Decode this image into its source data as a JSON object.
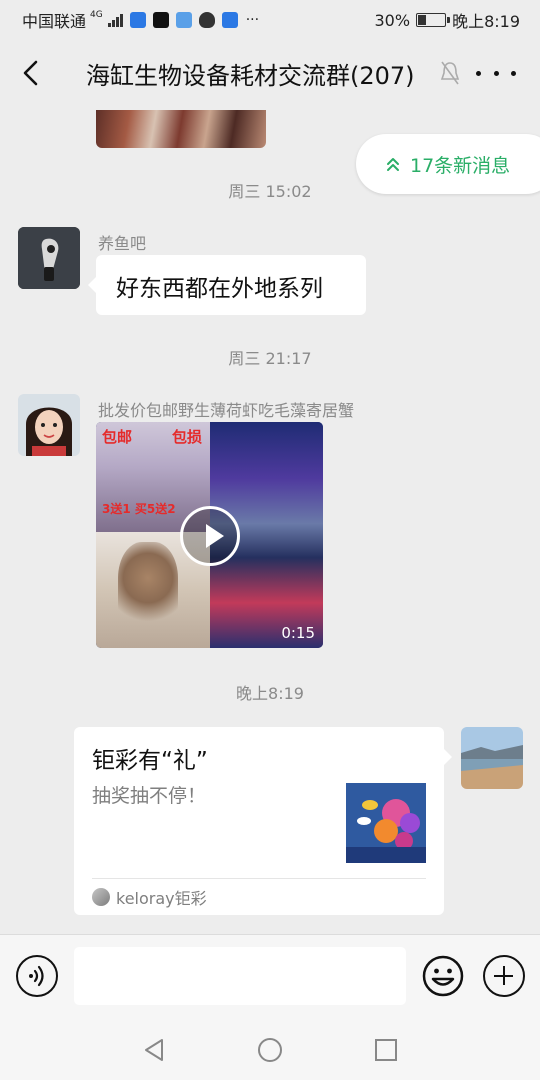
{
  "status_bar": {
    "carrier": "中国联通",
    "network": "4G",
    "battery_percent": "30%",
    "battery_level": 0.3,
    "time": "晚上8:19"
  },
  "header": {
    "title": "海缸生物设备耗材交流群(207)",
    "back_icon": "chevron-left-icon",
    "mute_icon": "bell-mute-icon",
    "more_icon": "more-dots-icon"
  },
  "new_messages_label": "17条新消息",
  "messages": [
    {
      "type": "timestamp",
      "text": "周三 15:02"
    },
    {
      "type": "text",
      "sender": "养鱼吧",
      "text": "好东西都在外地系列"
    },
    {
      "type": "timestamp",
      "text": "周三 21:17"
    },
    {
      "type": "video",
      "sender": "批发价包邮野生薄荷虾吃毛藻寄居蟹",
      "overlay_texts": [
        "包邮",
        "包损",
        "3送1 买5送2"
      ],
      "duration": "0:15"
    },
    {
      "type": "timestamp",
      "text": "晚上8:19"
    },
    {
      "type": "card",
      "title": "钜彩有“礼”",
      "description": "抽奖抽不停！",
      "source": "keloray钜彩"
    }
  ],
  "input_bar": {
    "voice_icon": "voice-icon",
    "input_value": "",
    "emoji_icon": "emoji-icon",
    "plus_icon": "plus-icon"
  },
  "nav_bar": {
    "icons": [
      "nav-back-icon",
      "nav-home-icon",
      "nav-recent-icon"
    ]
  },
  "colors": {
    "background": "#ededed",
    "accent_green": "#2aae67",
    "bubble": "#ffffff",
    "meta_text": "#8a8a8a"
  }
}
